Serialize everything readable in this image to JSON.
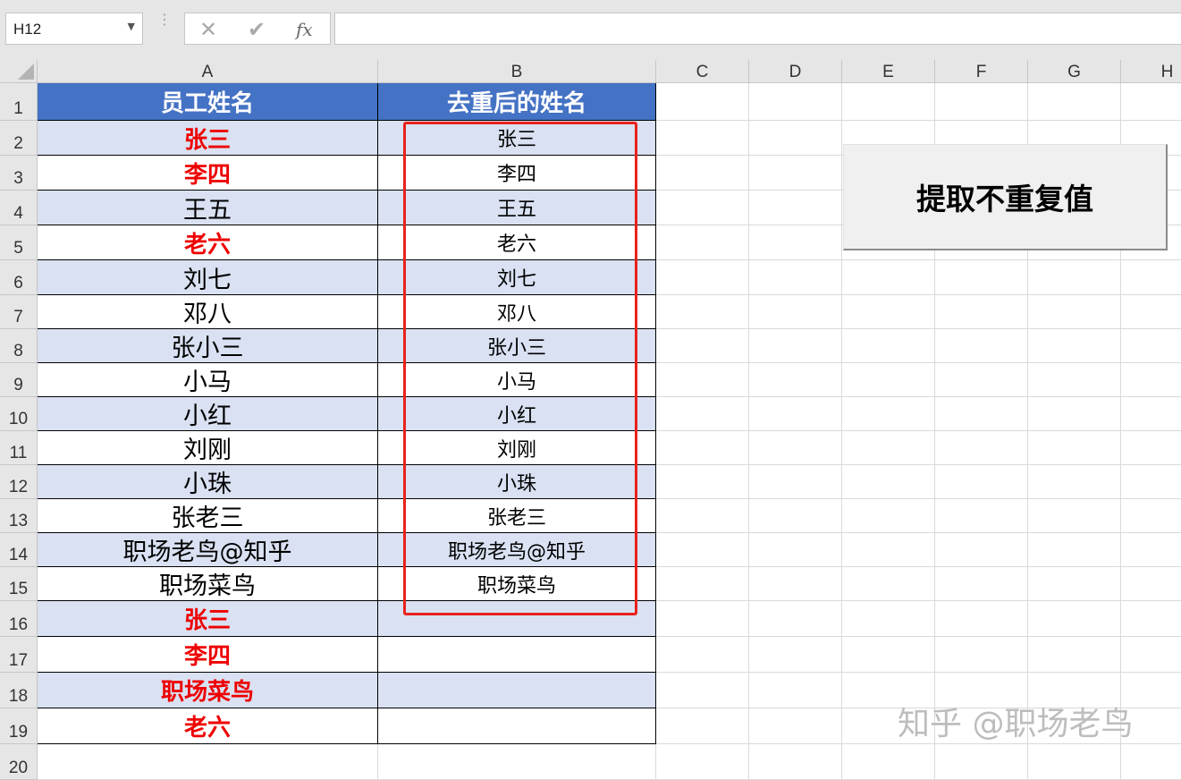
{
  "namebox": {
    "value": "H12"
  },
  "formula_bar": {
    "cancel_icon": "close-icon",
    "enter_icon": "check-icon",
    "fx_label": "fx",
    "value": ""
  },
  "columns": [
    "A",
    "B",
    "C",
    "D",
    "E",
    "F",
    "G",
    "H"
  ],
  "rows": [
    "1",
    "2",
    "3",
    "4",
    "5",
    "6",
    "7",
    "8",
    "9",
    "10",
    "11",
    "12",
    "13",
    "14",
    "15",
    "16",
    "17",
    "18",
    "19",
    "20"
  ],
  "table": {
    "headers": [
      "员工姓名",
      "去重后的姓名"
    ],
    "col_a": [
      {
        "text": "张三",
        "red": true
      },
      {
        "text": "李四",
        "red": true
      },
      {
        "text": "王五",
        "red": false
      },
      {
        "text": "老六",
        "red": true
      },
      {
        "text": "刘七",
        "red": false
      },
      {
        "text": "邓八",
        "red": false
      },
      {
        "text": "张小三",
        "red": false
      },
      {
        "text": "小马",
        "red": false
      },
      {
        "text": "小红",
        "red": false
      },
      {
        "text": "刘刚",
        "red": false
      },
      {
        "text": "小珠",
        "red": false
      },
      {
        "text": "张老三",
        "red": false
      },
      {
        "text": "职场老鸟@知乎",
        "red": false
      },
      {
        "text": "职场菜鸟",
        "red": false
      },
      {
        "text": "张三",
        "red": true
      },
      {
        "text": "李四",
        "red": true
      },
      {
        "text": "职场菜鸟",
        "red": true
      },
      {
        "text": "老六",
        "red": true
      }
    ],
    "col_b": [
      "张三",
      "李四",
      "王五",
      "老六",
      "刘七",
      "邓八",
      "张小三",
      "小马",
      "小红",
      "刘刚",
      "小珠",
      "张老三",
      "职场老鸟@知乎",
      "职场菜鸟",
      "",
      "",
      "",
      ""
    ]
  },
  "macro_button": {
    "label": "提取不重复值"
  },
  "watermark": "知乎 @职场老鸟",
  "colors": {
    "header_fill": "#4472c4",
    "band_fill": "#d9e1f2",
    "duplicate_text": "#ee0000",
    "highlight_box": "#e8221c"
  }
}
